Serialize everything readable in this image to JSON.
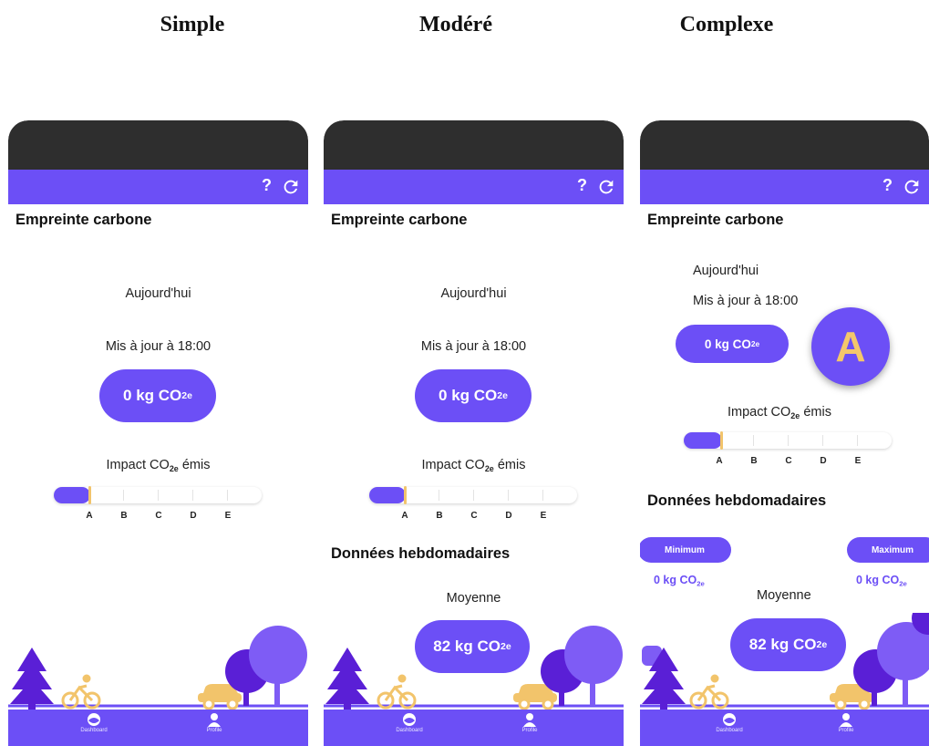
{
  "columns": {
    "simple": "Simple",
    "moderate": "Modéré",
    "complex": "Complexe"
  },
  "app": {
    "help_label": "?",
    "title": "Empreinte carbone",
    "today": "Aujourd'hui",
    "updated": "Mis à jour à 18:00",
    "daily_co2_prefix": "0 kg CO",
    "co2_subscript": "2e",
    "impact_prefix": "Impact CO",
    "impact_suffix": " émis",
    "grades": [
      "A",
      "B",
      "C",
      "D",
      "E"
    ],
    "current_grade": "A",
    "impact_fill_fraction": 0.17,
    "weekly_title": "Données hebdomadaires",
    "average_label": "Moyenne",
    "average_prefix": "82 kg CO",
    "minimum_label": "Minimum",
    "maximum_label": "Maximum",
    "min_value_prefix": "0 kg CO",
    "max_value_prefix": "0 kg CO",
    "nav": {
      "dashboard": "Dashboard",
      "profile": "Profile"
    }
  },
  "colors": {
    "accent": "#6c4ff6",
    "status_bar": "#2e2e2e",
    "tree_dark": "#5a1fd6",
    "tree_light": "#7e5cf5",
    "vehicle": "#f2c46b"
  },
  "icons": {
    "refresh": "refresh-icon",
    "dashboard": "dashboard-icon",
    "profile": "person-icon"
  }
}
